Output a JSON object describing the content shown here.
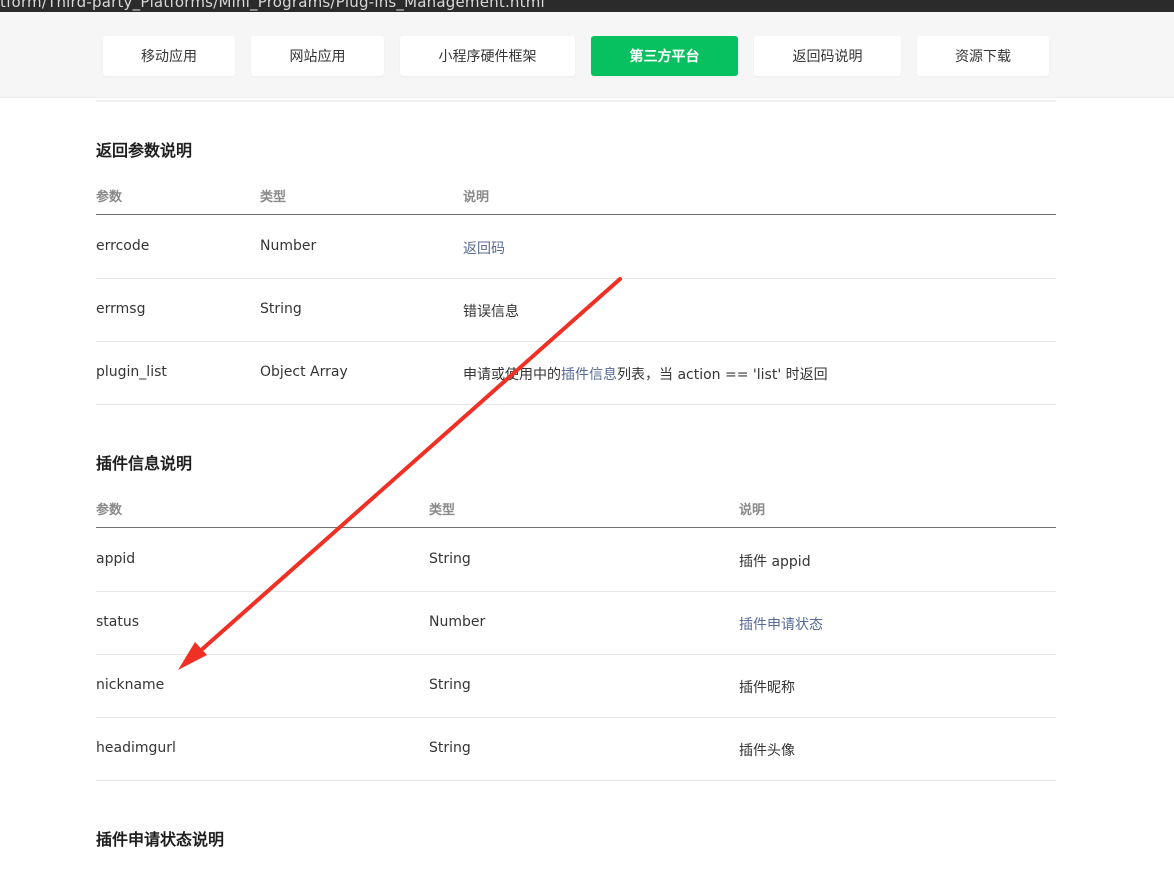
{
  "address_bar": {
    "url_fragment": "tform/Third-party_Platforms/Mini_Programs/Plug-ins_Management.html"
  },
  "tabs": [
    {
      "label": "移动应用",
      "active": false
    },
    {
      "label": "网站应用",
      "active": false
    },
    {
      "label": "小程序硬件框架",
      "active": false
    },
    {
      "label": "第三方平台",
      "active": true
    },
    {
      "label": "返回码说明",
      "active": false
    },
    {
      "label": "资源下载",
      "active": false
    }
  ],
  "accent_color": "#07c160",
  "link_color": "#576b95",
  "return_params": {
    "title": "返回参数说明",
    "headers": {
      "param": "参数",
      "type": "类型",
      "desc": "说明"
    },
    "rows": [
      {
        "param": "errcode",
        "type": "Number",
        "desc": "返回码"
      },
      {
        "param": "errmsg",
        "type": "String",
        "desc": "错误信息"
      },
      {
        "param": "plugin_list",
        "type": "Object Array",
        "desc_prefix": "申请或使用中的",
        "desc_link": "插件信息",
        "desc_suffix": "列表，当 action == 'list' 时返回"
      }
    ]
  },
  "plugin_info": {
    "title": "插件信息说明",
    "headers": {
      "param": "参数",
      "type": "类型",
      "desc": "说明"
    },
    "rows": [
      {
        "param": "appid",
        "type": "String",
        "desc": "插件 appid"
      },
      {
        "param": "status",
        "type": "Number",
        "desc": "插件申请状态"
      },
      {
        "param": "nickname",
        "type": "String",
        "desc": "插件昵称"
      },
      {
        "param": "headimgurl",
        "type": "String",
        "desc": "插件头像"
      }
    ]
  },
  "status_section": {
    "title": "插件申请状态说明"
  },
  "annotation": {
    "arrow_color": "#f03024"
  }
}
